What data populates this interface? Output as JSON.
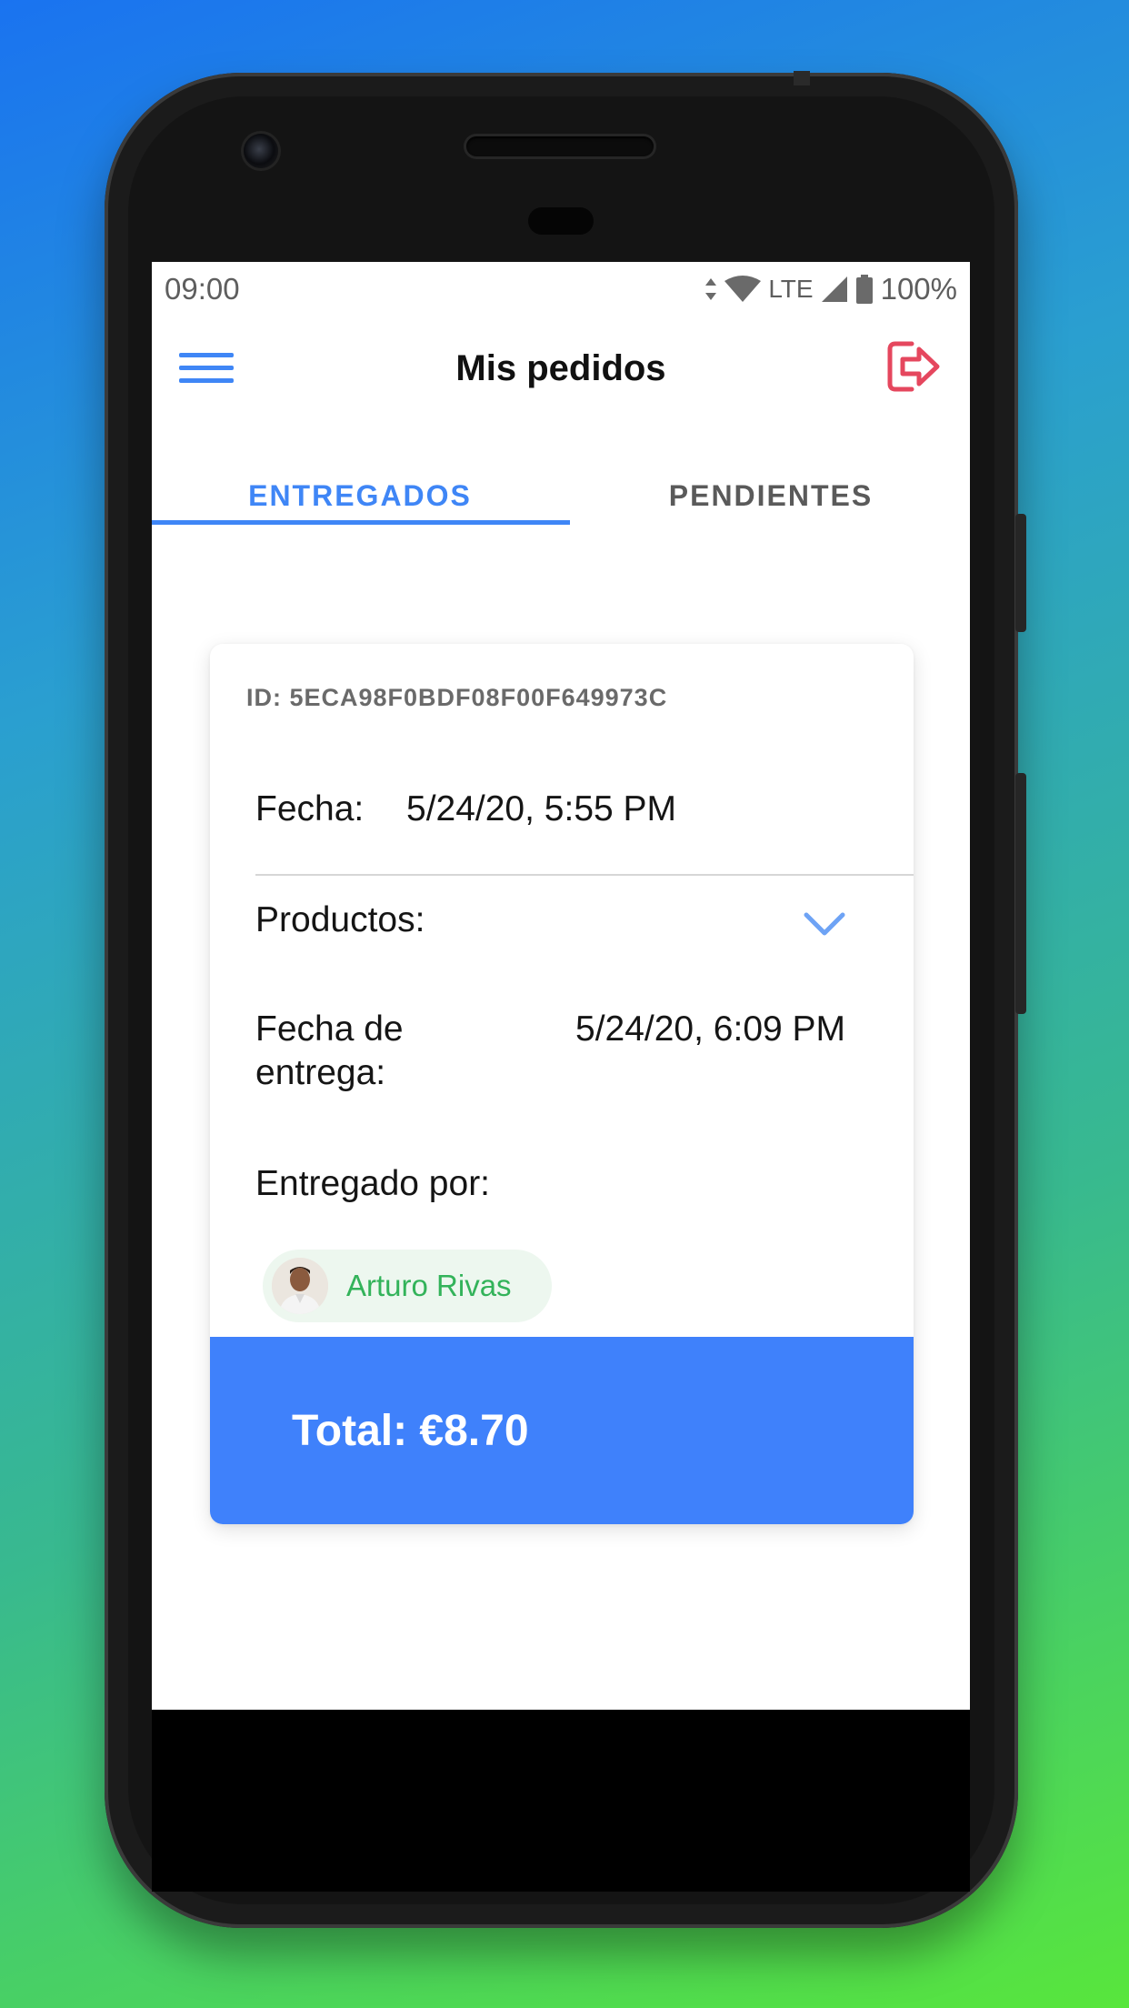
{
  "status_bar": {
    "time": "09:00",
    "network": "LTE",
    "battery": "100%"
  },
  "app_bar": {
    "title": "Mis pedidos",
    "menu_icon": "hamburger-menu-icon",
    "logout_icon": "logout-icon"
  },
  "tabs": [
    {
      "label": "ENTREGADOS",
      "active": true
    },
    {
      "label": "PENDIENTES",
      "active": false
    }
  ],
  "order": {
    "id": "ID: 5ECA98F0BDF08F00F649973C",
    "fecha_label": "Fecha:",
    "fecha_value": "5/24/20, 5:55 PM",
    "productos_label": "Productos:",
    "entrega_label": "Fecha de entrega:",
    "entrega_value": "5/24/20, 6:09 PM",
    "entregado_label": "Entregado por:",
    "courier_name": "Arturo Rivas",
    "total": "Total: €8.70"
  },
  "colors": {
    "accent": "#3f86f6",
    "logout": "#e5475e",
    "chip_text": "#33b35a",
    "total_bg": "#3f81fb"
  }
}
